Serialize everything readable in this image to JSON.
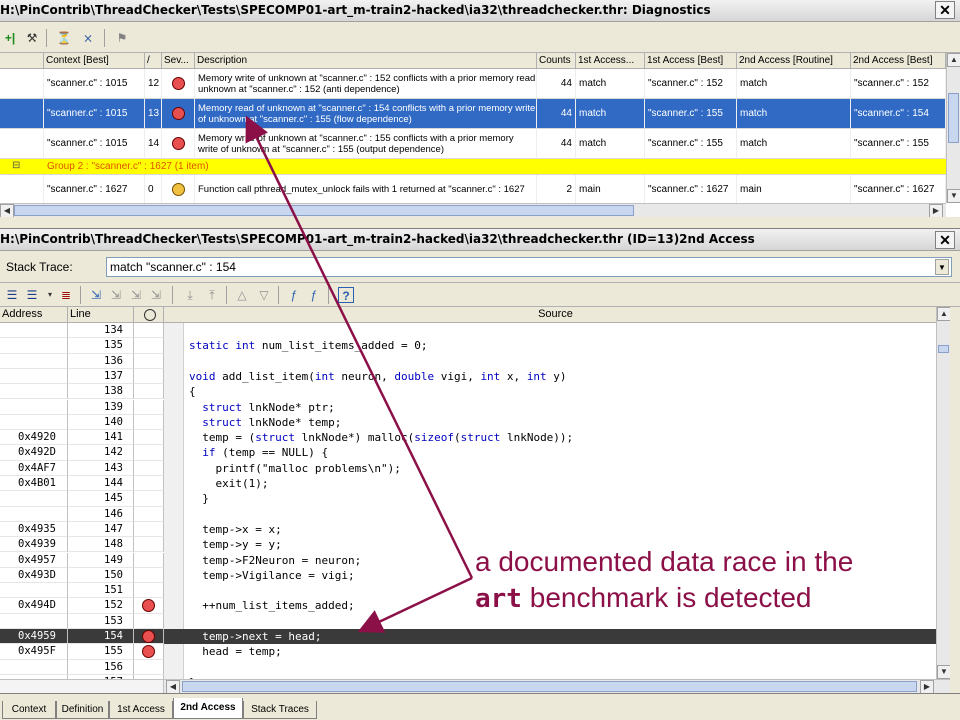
{
  "top_window": {
    "title": "H:\\PinContrib\\ThreadChecker\\Tests\\SPECOMP01-art_m-train2-hacked\\ia32\\threadchecker.thr: Diagnostics",
    "close": "✕",
    "toolbar_icons": [
      "plus-icon",
      "tools-icon",
      "filter-icon",
      "filter-remove-icon",
      "flag-icon"
    ],
    "columns": [
      "Context [Best]",
      "ID",
      "Sev...",
      "Description",
      "Counts",
      "1st Access...",
      "1st Access [Best]",
      "2nd Access [Routine]",
      "2nd Access [Best]"
    ],
    "id_header_glyph": "/",
    "rows": [
      {
        "context": "\"scanner.c\" : 1015",
        "id": "12",
        "sev": "red",
        "desc": "Memory write of unknown at \"scanner.c\" : 152 conflicts with a prior memory read unknown at \"scanner.c\" : 152 (anti dependence)",
        "counts": "44",
        "first": "match",
        "first_best": "\"scanner.c\" : 152",
        "second": "match",
        "second_best": "\"scanner.c\" : 152",
        "selected": false
      },
      {
        "context": "\"scanner.c\" : 1015",
        "id": "13",
        "sev": "red",
        "desc": "Memory read of unknown at \"scanner.c\" : 154 conflicts with a prior memory write of unknown at \"scanner.c\" : 155 (flow dependence)",
        "counts": "44",
        "first": "match",
        "first_best": "\"scanner.c\" : 155",
        "second": "match",
        "second_best": "\"scanner.c\" : 154",
        "selected": true
      },
      {
        "context": "\"scanner.c\" : 1015",
        "id": "14",
        "sev": "red",
        "desc": "Memory write of unknown at \"scanner.c\" : 155 conflicts with a prior memory write of unknown at \"scanner.c\" : 155 (output dependence)",
        "counts": "44",
        "first": "match",
        "first_best": "\"scanner.c\" : 155",
        "second": "match",
        "second_best": "\"scanner.c\" : 155",
        "selected": false
      }
    ],
    "group_label": "Group 2 : \"scanner.c\" : 1627 (1 item)",
    "group_toggle": "⊟",
    "last_row": {
      "context": "\"scanner.c\" : 1627",
      "id": "0",
      "sev": "yellow",
      "desc": "Function call pthread_mutex_unlock fails with 1 returned at \"scanner.c\" : 1627",
      "counts": "2",
      "first": "main",
      "first_best": "\"scanner.c\" : 1627",
      "second": "main",
      "second_best": "\"scanner.c\" : 1627"
    }
  },
  "bottom_window": {
    "title": "H:\\PinContrib\\ThreadChecker\\Tests\\SPECOMP01-art_m-train2-hacked\\ia32\\threadchecker.thr (ID=13)2nd Access",
    "close": "✕",
    "stack_trace_label": "Stack Trace:",
    "stack_trace_value": "match \"scanner.c\" : 154",
    "columns": {
      "address": "Address",
      "line": "Line",
      "source": "Source"
    },
    "lines": [
      {
        "addr": "",
        "line": "134",
        "bp": "",
        "code": ""
      },
      {
        "addr": "",
        "line": "135",
        "bp": "",
        "code": "static int num_list_items_added = 0;"
      },
      {
        "addr": "",
        "line": "136",
        "bp": "",
        "code": ""
      },
      {
        "addr": "",
        "line": "137",
        "bp": "",
        "code": "void add_list_item(int neuron, double vigi, int x, int y)"
      },
      {
        "addr": "",
        "line": "138",
        "bp": "",
        "code": "{"
      },
      {
        "addr": "",
        "line": "139",
        "bp": "",
        "code": "  struct lnkNode* ptr;"
      },
      {
        "addr": "",
        "line": "140",
        "bp": "",
        "code": "  struct lnkNode* temp;"
      },
      {
        "addr": "0x4920",
        "line": "141",
        "bp": "",
        "code": "  temp = (struct lnkNode*) malloc(sizeof(struct lnkNode));"
      },
      {
        "addr": "0x492D",
        "line": "142",
        "bp": "",
        "code": "  if (temp == NULL) {"
      },
      {
        "addr": "0x4AF7",
        "line": "143",
        "bp": "",
        "code": "    printf(\"malloc problems\\n\");"
      },
      {
        "addr": "0x4B01",
        "line": "144",
        "bp": "",
        "code": "    exit(1);"
      },
      {
        "addr": "",
        "line": "145",
        "bp": "",
        "code": "  }"
      },
      {
        "addr": "",
        "line": "146",
        "bp": "",
        "code": ""
      },
      {
        "addr": "0x4935",
        "line": "147",
        "bp": "",
        "code": "  temp->x = x;"
      },
      {
        "addr": "0x4939",
        "line": "148",
        "bp": "",
        "code": "  temp->y = y;"
      },
      {
        "addr": "0x4957",
        "line": "149",
        "bp": "",
        "code": "  temp->F2Neuron = neuron;"
      },
      {
        "addr": "0x493D",
        "line": "150",
        "bp": "",
        "code": "  temp->Vigilance = vigi;"
      },
      {
        "addr": "",
        "line": "151",
        "bp": "",
        "code": ""
      },
      {
        "addr": "0x494D",
        "line": "152",
        "bp": "red",
        "code": "  ++num_list_items_added;"
      },
      {
        "addr": "",
        "line": "153",
        "bp": "",
        "code": ""
      },
      {
        "addr": "0x4959",
        "line": "154",
        "bp": "red",
        "code": "  temp->next = head;",
        "highlight": true
      },
      {
        "addr": "0x495F",
        "line": "155",
        "bp": "red",
        "code": "  head = temp;"
      },
      {
        "addr": "",
        "line": "156",
        "bp": "",
        "code": ""
      },
      {
        "addr": "",
        "line": "157",
        "bp": "",
        "code": "}"
      }
    ],
    "tabs": [
      "Context",
      "Definition",
      "1st Access",
      "2nd Access",
      "Stack Traces"
    ],
    "active_tab": "2nd Access"
  },
  "annotation": {
    "line1": "a documented data race in the",
    "line2_code": "art",
    "line2_rest": " benchmark is detected",
    "color": "#8c1048"
  }
}
